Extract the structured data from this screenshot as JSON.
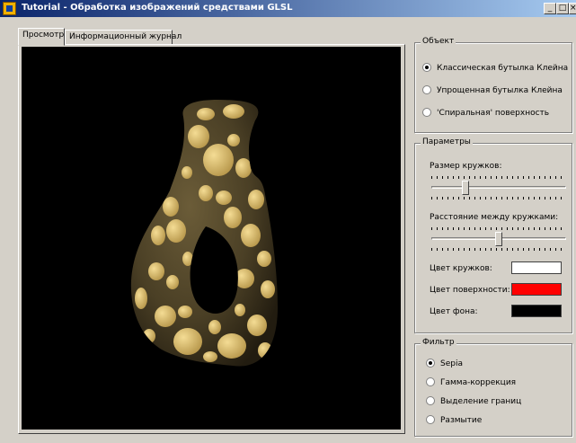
{
  "window": {
    "title": "Tutorial - Обработка изображений средствами GLSL"
  },
  "tabs": [
    {
      "label": "Просмотр",
      "active": true
    },
    {
      "label": "Информационный журнал",
      "active": false
    }
  ],
  "object_group": {
    "title": "Объект",
    "options": [
      {
        "label": "Классическая бутылка Клейна",
        "checked": true
      },
      {
        "label": "Упрощенная бутылка Клейна",
        "checked": false
      },
      {
        "label": "'Спиральная' поверхность",
        "checked": false
      }
    ]
  },
  "params_group": {
    "title": "Параметры",
    "spot_size": {
      "label": "Размер кружков:",
      "value": 0.25
    },
    "spot_spacing": {
      "label": "Расстояние между кружками:",
      "value": 0.5
    },
    "colors": [
      {
        "label": "Цвет кружков:",
        "color": "#ffffff"
      },
      {
        "label": "Цвет поверхности:",
        "color": "#ff0000"
      },
      {
        "label": "Цвет фона:",
        "color": "#000000"
      }
    ]
  },
  "filter_group": {
    "title": "Фильтр",
    "options": [
      {
        "label": "Sepia",
        "checked": true
      },
      {
        "label": "Гамма-коррекция",
        "checked": false
      },
      {
        "label": "Выделение границ",
        "checked": false
      },
      {
        "label": "Размытие",
        "checked": false
      }
    ]
  },
  "render": {
    "surface_color": "#4a3f25",
    "spot_color": "#e8c878",
    "background": "#000000"
  }
}
